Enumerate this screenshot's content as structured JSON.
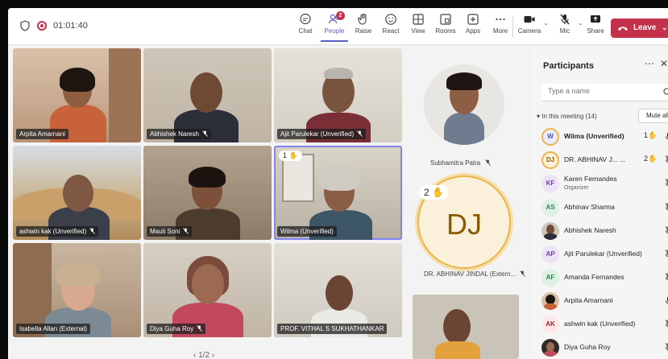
{
  "toolbar": {
    "timer": "01:01:40",
    "buttons": [
      {
        "id": "chat",
        "label": "Chat"
      },
      {
        "id": "people",
        "label": "People",
        "badge": "2"
      },
      {
        "id": "raise",
        "label": "Raise"
      },
      {
        "id": "react",
        "label": "React"
      },
      {
        "id": "view",
        "label": "View"
      },
      {
        "id": "rooms",
        "label": "Rooms"
      },
      {
        "id": "apps",
        "label": "Apps"
      },
      {
        "id": "more",
        "label": "More"
      },
      {
        "id": "camera",
        "label": "Camera"
      },
      {
        "id": "mic",
        "label": "Mic"
      },
      {
        "id": "share",
        "label": "Share"
      }
    ],
    "leave_label": "Leave",
    "accent": "#5b5fc7",
    "leave_color": "#c4314b"
  },
  "grid": {
    "tiles": [
      {
        "name": "Arpita Amarnani",
        "muted": false
      },
      {
        "name": "Abhishek Naresh",
        "muted": true
      },
      {
        "name": "Ajit Parulekar (Unverified)",
        "muted": true
      },
      {
        "name": "ashwin kak (Unverified)",
        "muted": true
      },
      {
        "name": "Mauli Soni",
        "muted": true
      },
      {
        "name": "Wilma (Unverified)",
        "muted": false,
        "hand": "1",
        "speaking": true
      },
      {
        "name": "Isabella Allan (External)",
        "muted": false
      },
      {
        "name": "Diya Guha Roy",
        "muted": true
      },
      {
        "name": "PROF. VITHAL S SUKHATHANKAR",
        "muted": false
      }
    ],
    "pager": "1/2"
  },
  "middle": {
    "top_name": "Subhamitra Patra",
    "dj_initials": "DJ",
    "dj_hand": "2",
    "dj_name": "DR. ABHINAV JINDAL (Extern..."
  },
  "participants": {
    "title": "Participants",
    "search_placeholder": "Type a name",
    "section": "In this meeting (14)",
    "mute_all": "Mute all",
    "list": [
      {
        "initials": "W",
        "name": "Wilma (Unverified)",
        "bold": true,
        "hand": "1",
        "mic": "on",
        "avatar_bg": "#e8ebfa",
        "avatar_fg": "#4f52b2",
        "ring": true
      },
      {
        "initials": "DJ",
        "name": "DR. ABHINAV J... ...",
        "bold": false,
        "hand": "2",
        "mic": "off",
        "avatar_bg": "#fbf1da",
        "avatar_fg": "#8a5a00",
        "ring": true
      },
      {
        "initials": "KF",
        "name": "Karen Fernandes",
        "sub": "Organizer",
        "mic": "off",
        "avatar_bg": "#ede3f6",
        "avatar_fg": "#6b3fa0"
      },
      {
        "initials": "AS",
        "name": "Abhinav Sharma",
        "mic": "off",
        "avatar_bg": "#dff1e4",
        "avatar_fg": "#2e7d4f"
      },
      {
        "initials": "",
        "name": "Abhishek Naresh",
        "mic": "off",
        "photo": true
      },
      {
        "initials": "AP",
        "name": "Ajit Parulekar (Unverified)",
        "mic": "off",
        "avatar_bg": "#ede3f6",
        "avatar_fg": "#6b3fa0"
      },
      {
        "initials": "AF",
        "name": "Amanda Fernandes",
        "mic": "off",
        "avatar_bg": "#dff1e4",
        "avatar_fg": "#2e7d4f"
      },
      {
        "initials": "",
        "name": "Arpita Amarnani",
        "mic": "on",
        "photo": true
      },
      {
        "initials": "AK",
        "name": "ashwin kak (Unverified)",
        "mic": "off",
        "avatar_bg": "#fde7e9",
        "avatar_fg": "#a4262c"
      },
      {
        "initials": "",
        "name": "Diya Guha Roy",
        "mic": "off",
        "photo": true
      }
    ]
  }
}
